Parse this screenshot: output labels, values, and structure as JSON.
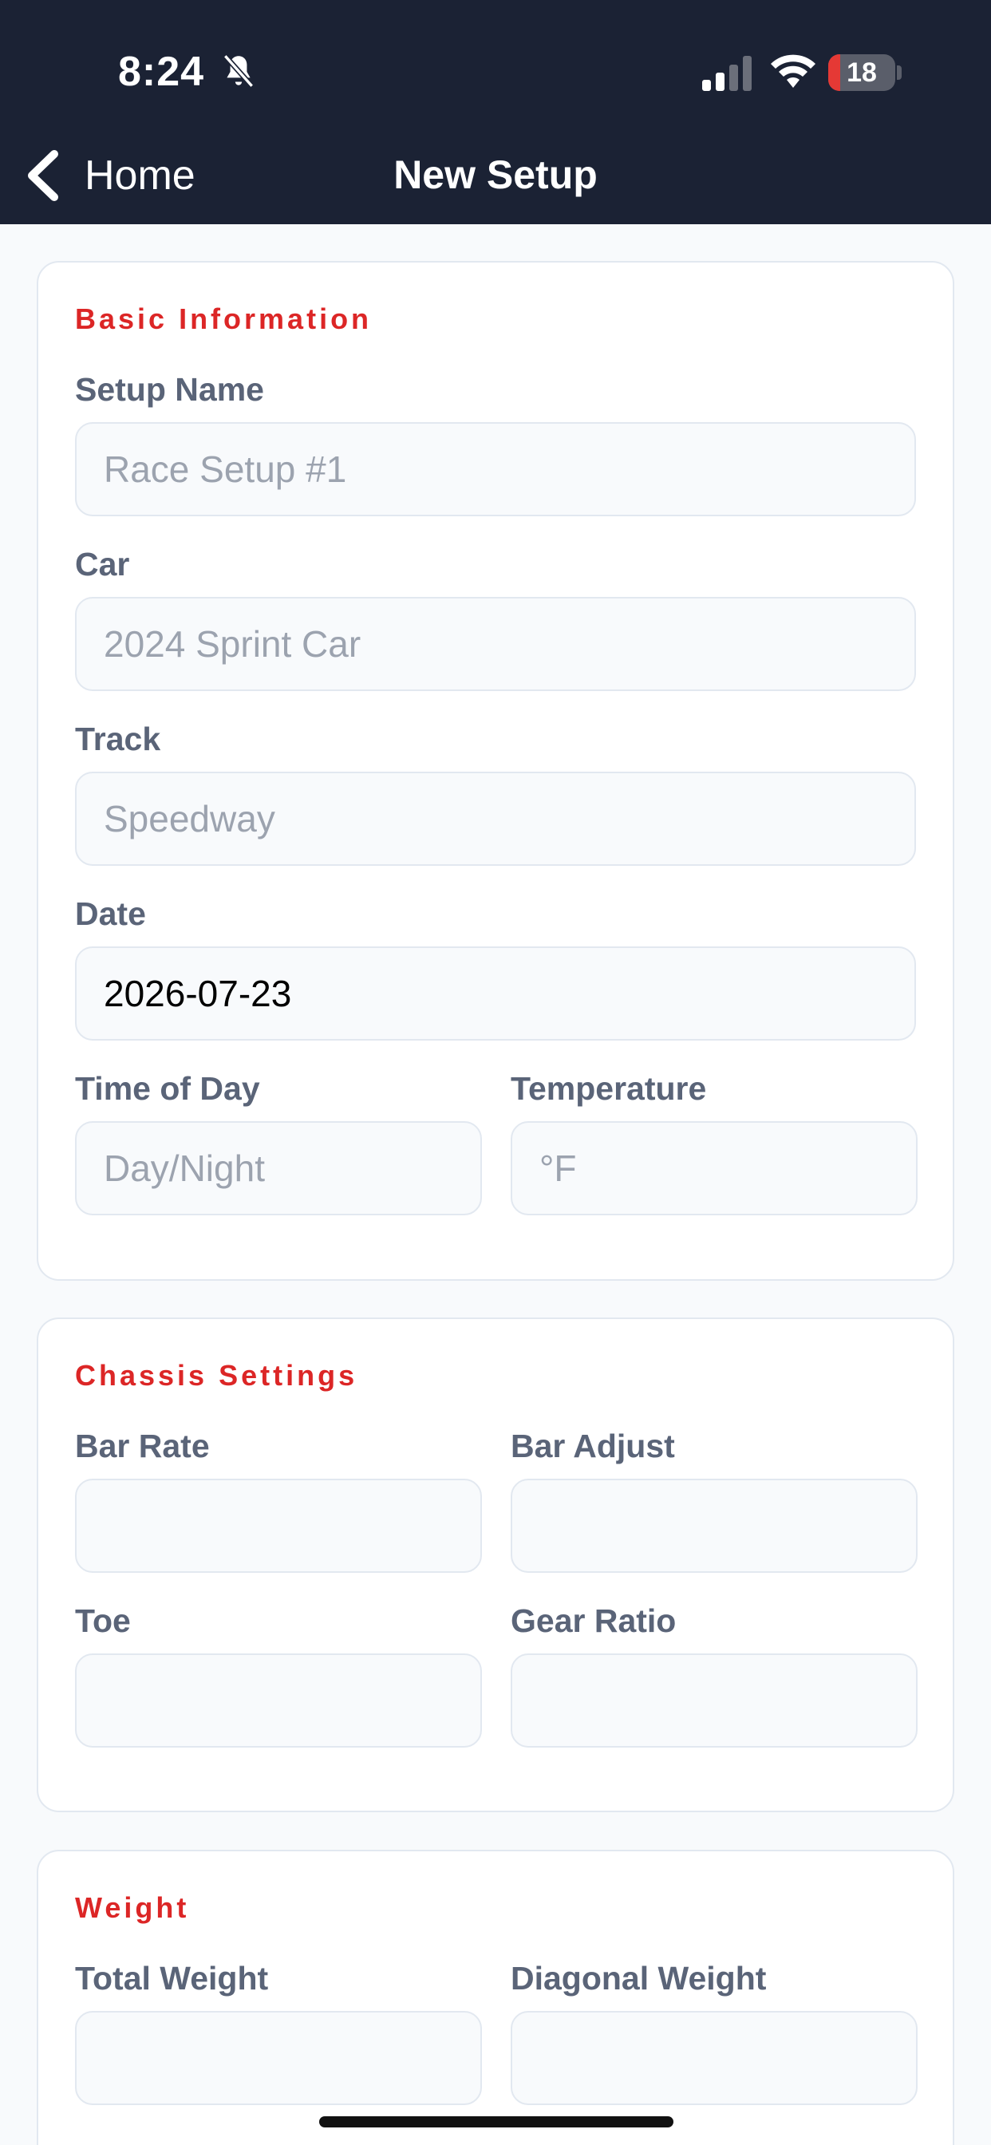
{
  "status_bar": {
    "time": "8:24",
    "battery": "18",
    "battery_percent": 18,
    "icons": [
      "bell-slash-icon",
      "cellular-signal-icon",
      "wifi-icon",
      "battery-icon"
    ]
  },
  "nav": {
    "back_label": "Home",
    "title": "New Setup"
  },
  "colors": {
    "header_bg": "#1b2234",
    "section_title": "#dc2626",
    "label": "#5a6478",
    "battery_low": "#e53935"
  },
  "basic": {
    "title": "Basic Information",
    "setup_name_label": "Setup Name",
    "setup_name_placeholder": "Race Setup #1",
    "car_label": "Car",
    "car_placeholder": "2024 Sprint Car",
    "track_label": "Track",
    "track_placeholder": "Speedway",
    "date_label": "Date",
    "date_value": "2026-07-23",
    "time_of_day_label": "Time of Day",
    "time_of_day_placeholder": "Day/Night",
    "temperature_label": "Temperature",
    "temperature_placeholder": "°F"
  },
  "chassis": {
    "title": "Chassis Settings",
    "bar_rate_label": "Bar Rate",
    "bar_adjust_label": "Bar Adjust",
    "toe_label": "Toe",
    "gear_ratio_label": "Gear Ratio"
  },
  "weight": {
    "title": "Weight",
    "total_weight_label": "Total Weight",
    "diagonal_weight_label": "Diagonal Weight"
  }
}
